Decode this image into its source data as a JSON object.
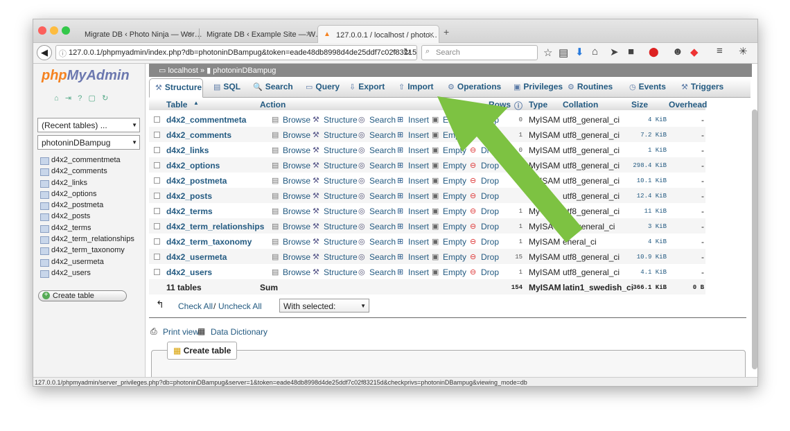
{
  "browser": {
    "tabs": [
      {
        "label": "Migrate DB ‹ Photo Ninja — Wor…"
      },
      {
        "label": "Migrate DB ‹ Example Site — W…"
      },
      {
        "label": "127.0.0.1 / localhost / photo…"
      }
    ],
    "url": "127.0.0.1/phpmyadmin/index.php?db=photoninDBampug&token=eade48db8998d4de25ddf7c02f83215",
    "search_placeholder": "Search",
    "status_url": "127.0.0.1/phpmyadmin/server_privileges.php?db=photoninDBampug&server=1&token=eade48db8998d4de25ddf7c02f83215d&checkprivs=photoninDBampug&viewing_mode=db"
  },
  "sidebar": {
    "logo_php": "php",
    "logo_my": "MyAdmin",
    "recent": "(Recent tables) ...",
    "db": "photoninDBampug",
    "tables": [
      "d4x2_commentmeta",
      "d4x2_comments",
      "d4x2_links",
      "d4x2_options",
      "d4x2_postmeta",
      "d4x2_posts",
      "d4x2_terms",
      "d4x2_term_relationships",
      "d4x2_term_taxonomy",
      "d4x2_usermeta",
      "d4x2_users"
    ],
    "create_table": "Create table"
  },
  "breadcrumb": {
    "server": "localhost",
    "sep": "»",
    "db": "photoninDBampug"
  },
  "tabs": [
    "Structure",
    "SQL",
    "Search",
    "Query",
    "Export",
    "Import",
    "Operations",
    "Privileges",
    "Routines",
    "Events",
    "Triggers"
  ],
  "headers": {
    "table": "Table",
    "action": "Action",
    "rows": "Rows",
    "type": "Type",
    "collation": "Collation",
    "size": "Size",
    "overhead": "Overhead"
  },
  "actions": {
    "browse": "Browse",
    "structure": "Structure",
    "search": "Search",
    "insert": "Insert",
    "empty": "Empty",
    "drop": "Drop"
  },
  "rows": [
    {
      "name": "d4x2_commentmeta",
      "rows": "0",
      "type": "MyISAM",
      "collation": "utf8_general_ci",
      "size": "4 KiB",
      "overhead": "-"
    },
    {
      "name": "d4x2_comments",
      "rows": "1",
      "type": "MyISAM",
      "collation": "utf8_general_ci",
      "size": "7.2 KiB",
      "overhead": "-"
    },
    {
      "name": "d4x2_links",
      "rows": "0",
      "type": "MyISAM",
      "collation": "utf8_general_ci",
      "size": "1 KiB",
      "overhead": "-"
    },
    {
      "name": "d4x2_options",
      "rows": "130",
      "type": "MyISAM",
      "collation": "utf8_general_ci",
      "size": "298.4 KiB",
      "overhead": "-"
    },
    {
      "name": "d4x2_postmeta",
      "rows": "",
      "type": "MyISAM",
      "collation": "utf8_general_ci",
      "size": "10.1 KiB",
      "overhead": "-"
    },
    {
      "name": "d4x2_posts",
      "rows": "",
      "type": "ISAM",
      "collation": "utf8_general_ci",
      "size": "12.4 KiB",
      "overhead": "-"
    },
    {
      "name": "d4x2_terms",
      "rows": "1",
      "type": "My",
      "collation": "utf8_general_ci",
      "size": "11 KiB",
      "overhead": "-"
    },
    {
      "name": "d4x2_term_relationships",
      "rows": "1",
      "type": "MyISA",
      "collation": "tf8_general_ci",
      "size": "3 KiB",
      "overhead": "-"
    },
    {
      "name": "d4x2_term_taxonomy",
      "rows": "1",
      "type": "MyISAM",
      "collation": "eneral_ci",
      "size": "4 KiB",
      "overhead": "-"
    },
    {
      "name": "d4x2_usermeta",
      "rows": "15",
      "type": "MyISAM",
      "collation": "utf8_general_ci",
      "size": "10.9 KiB",
      "overhead": "-"
    },
    {
      "name": "d4x2_users",
      "rows": "1",
      "type": "MyISAM",
      "collation": "utf8_general_ci",
      "size": "4.1 KiB",
      "overhead": "-"
    }
  ],
  "footer": {
    "count": "11 tables",
    "sum": "Sum",
    "rows": "154",
    "type": "MyISAM",
    "collation": "latin1_swedish_ci",
    "size": "366.1 KiB",
    "overhead": "0 B"
  },
  "below": {
    "check_all": "Check All",
    "slash": "/",
    "uncheck_all": "Uncheck All",
    "with_selected": "With selected:",
    "print_view": "Print view",
    "data_dictionary": "Data Dictionary",
    "create_table": "Create table"
  },
  "colors": {
    "link": "#235a81",
    "arrow": "#7dc242",
    "logo_orange": "#f58220",
    "logo_blue": "#6c78af"
  }
}
